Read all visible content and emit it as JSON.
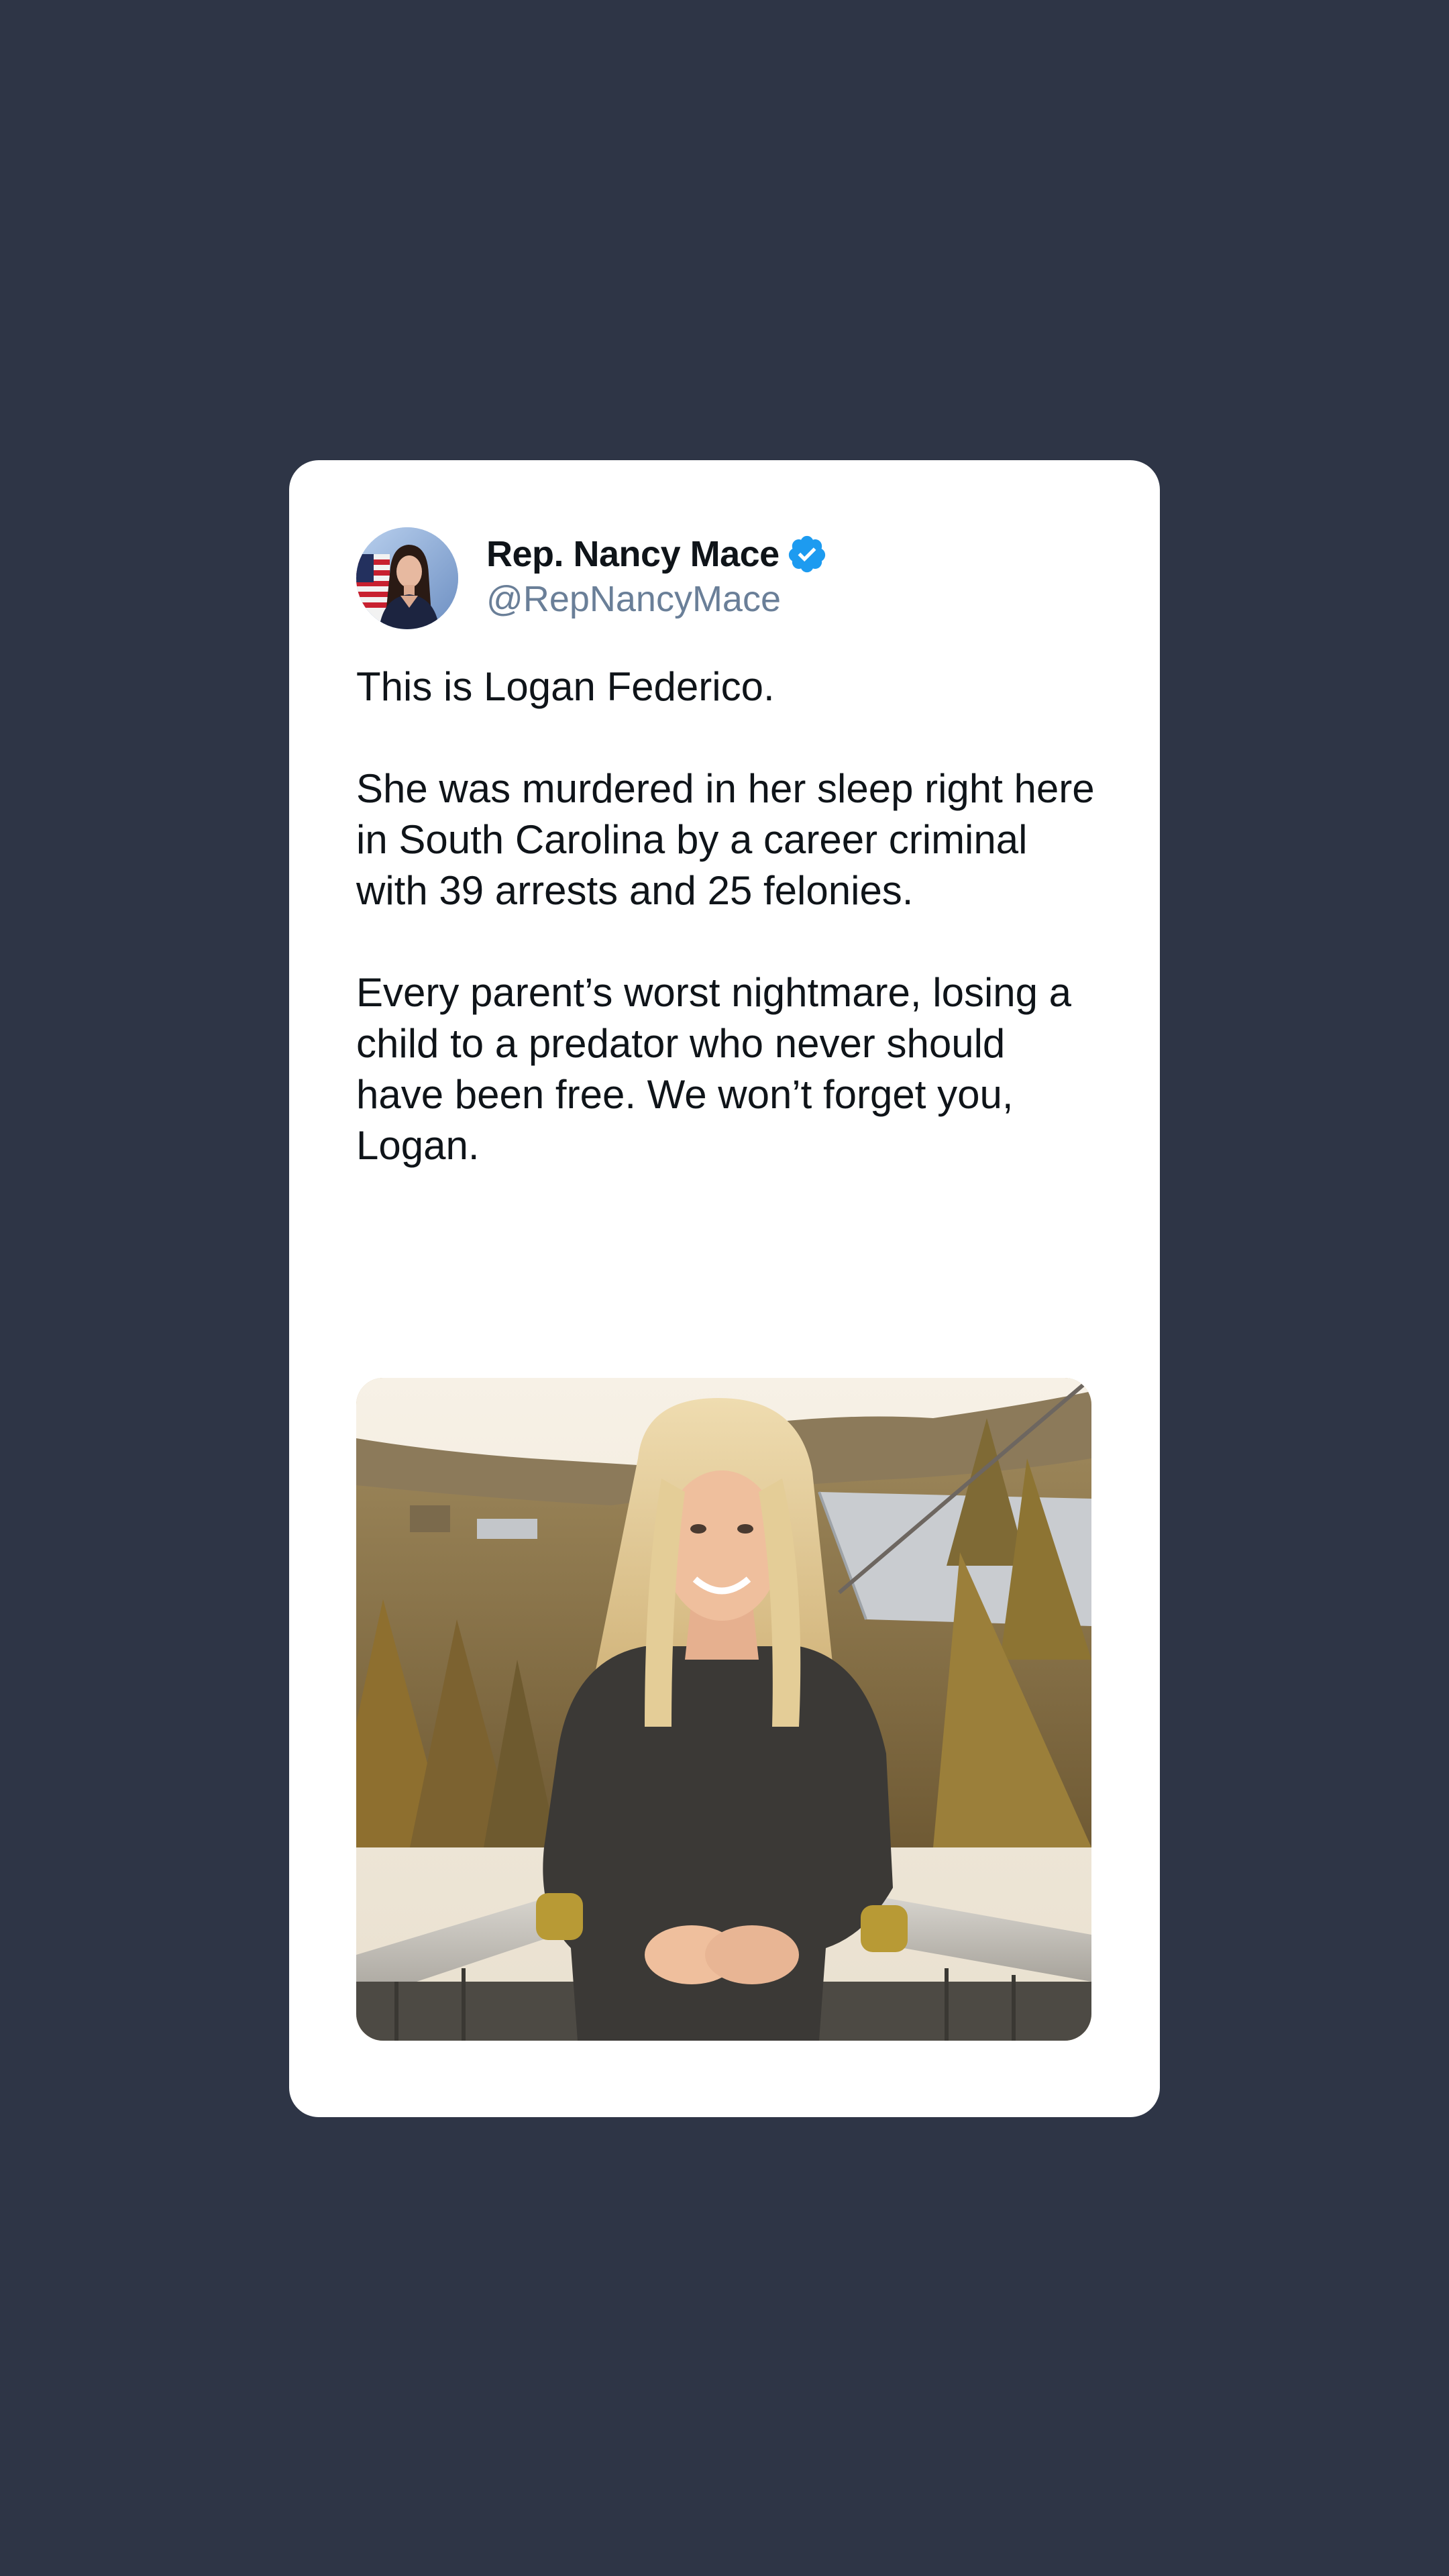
{
  "author": {
    "display_name": "Rep. Nancy Mace",
    "handle": "@RepNancyMace",
    "verified": true,
    "avatar_icon": "avatar-portrait",
    "verified_icon": "verified-badge-icon"
  },
  "tweet": {
    "paragraphs": [
      "This is Logan Federico.",
      "She was murdered in her sleep right here in South Carolina by a career criminal with 39 arrests and 25 felonies.",
      "Every parent’s worst nightmare, losing a child to a predator who never should have been free. We won’t forget you, Logan."
    ]
  },
  "media": {
    "type": "photo"
  },
  "colors": {
    "background": "#2e3546",
    "card": "#ffffff",
    "text": "#0f1419",
    "handle": "#6a7f98",
    "verified": "#1d9bf0"
  }
}
